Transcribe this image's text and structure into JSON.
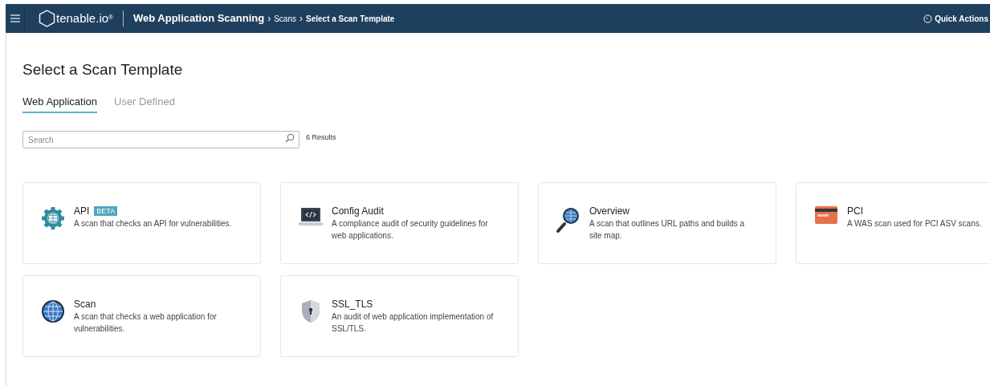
{
  "header": {
    "logo": "tenable.io",
    "logo_mark": "®",
    "app": "Web Application Scanning",
    "breadcrumbs": [
      {
        "separator": "›",
        "label": "Scans",
        "current": false
      },
      {
        "separator": "›",
        "label": "Select a Scan Template",
        "current": true
      }
    ],
    "quick_actions": "Quick Actions"
  },
  "title": "Select a Scan Template",
  "tabs": [
    {
      "label": "Web Application",
      "selected": true
    },
    {
      "label": "User Defined",
      "selected": false
    }
  ],
  "search": {
    "placeholder": "Search"
  },
  "results": "6 Results",
  "templates": [
    {
      "name": "API",
      "badge": "BETA",
      "description": "A scan that checks an API for vulnerabilities.",
      "kind": "gear"
    },
    {
      "name": "Config Audit",
      "description": "A compliance audit of security guidelines for web applications.",
      "kind": "laptop"
    },
    {
      "name": "Overview",
      "description": "A scan that outlines URL paths and builds a site map.",
      "kind": "magnifier"
    },
    {
      "name": "PCI",
      "description": "A WAS scan used for PCI ASV scans.",
      "kind": "card"
    },
    {
      "name": "Scan",
      "description": "A scan that checks a web application for vulnerabilities.",
      "kind": "globe"
    },
    {
      "name": "SSL_TLS",
      "description": "An audit of web application implementation of SSL/TLS.",
      "kind": "shield"
    }
  ]
}
